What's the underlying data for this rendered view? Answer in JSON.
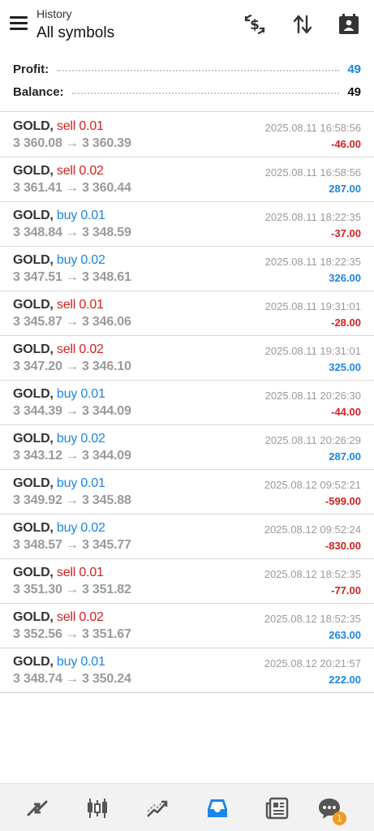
{
  "header": {
    "subtitle": "History",
    "title": "All symbols",
    "icons": [
      "menu-icon",
      "dollar-exchange-icon",
      "sort-icon",
      "calendar-icon"
    ]
  },
  "summary": {
    "profit_label": "Profit:",
    "profit_value": "49",
    "balance_label": "Balance:",
    "balance_value": "49"
  },
  "colors": {
    "sell": "#d32020",
    "buy": "#1a86e8",
    "accent": "#1a86e8",
    "badge": "#f29a1f"
  },
  "deals": [
    {
      "symbol": "GOLD,",
      "side": "sell",
      "volume": "sell 0.01",
      "prices": "3 360.08 → 3 360.39",
      "time": "2025.08.11 16:58:56",
      "pnl": "-46.00"
    },
    {
      "symbol": "GOLD,",
      "side": "sell",
      "volume": "sell 0.02",
      "prices": "3 361.41 → 3 360.44",
      "time": "2025.08.11 16:58:56",
      "pnl": "287.00"
    },
    {
      "symbol": "GOLD,",
      "side": "buy",
      "volume": "buy 0.01",
      "prices": "3 348.84 → 3 348.59",
      "time": "2025.08.11 18:22:35",
      "pnl": "-37.00"
    },
    {
      "symbol": "GOLD,",
      "side": "buy",
      "volume": "buy 0.02",
      "prices": "3 347.51 → 3 348.61",
      "time": "2025.08.11 18:22:35",
      "pnl": "326.00"
    },
    {
      "symbol": "GOLD,",
      "side": "sell",
      "volume": "sell 0.01",
      "prices": "3 345.87 → 3 346.06",
      "time": "2025.08.11 19:31:01",
      "pnl": "-28.00"
    },
    {
      "symbol": "GOLD,",
      "side": "sell",
      "volume": "sell 0.02",
      "prices": "3 347.20 → 3 346.10",
      "time": "2025.08.11 19:31:01",
      "pnl": "325.00"
    },
    {
      "symbol": "GOLD,",
      "side": "buy",
      "volume": "buy 0.01",
      "prices": "3 344.39 → 3 344.09",
      "time": "2025.08.11 20:26:30",
      "pnl": "-44.00"
    },
    {
      "symbol": "GOLD,",
      "side": "buy",
      "volume": "buy 0.02",
      "prices": "3 343.12 → 3 344.09",
      "time": "2025.08.11 20:26:29",
      "pnl": "287.00"
    },
    {
      "symbol": "GOLD,",
      "side": "buy",
      "volume": "buy 0.01",
      "prices": "3 349.92 → 3 345.88",
      "time": "2025.08.12 09:52:21",
      "pnl": "-599.00"
    },
    {
      "symbol": "GOLD,",
      "side": "buy",
      "volume": "buy 0.02",
      "prices": "3 348.57 → 3 345.77",
      "time": "2025.08.12 09:52:24",
      "pnl": "-830.00"
    },
    {
      "symbol": "GOLD,",
      "side": "sell",
      "volume": "sell 0.01",
      "prices": "3 351.30 → 3 351.82",
      "time": "2025.08.12 18:52:35",
      "pnl": "-77.00"
    },
    {
      "symbol": "GOLD,",
      "side": "sell",
      "volume": "sell 0.02",
      "prices": "3 352.56 → 3 351.67",
      "time": "2025.08.12 18:52:35",
      "pnl": "263.00"
    },
    {
      "symbol": "GOLD,",
      "side": "buy",
      "volume": "buy 0.01",
      "prices": "3 348.74 → 3 350.24",
      "time": "2025.08.12 20:21:57",
      "pnl": "222.00"
    }
  ],
  "bottom_nav": {
    "items": [
      "quotes-icon",
      "chart-icon",
      "trade-icon",
      "history-icon",
      "news-icon",
      "chat-icon"
    ],
    "active": "history-icon",
    "chat_badge": "1"
  }
}
